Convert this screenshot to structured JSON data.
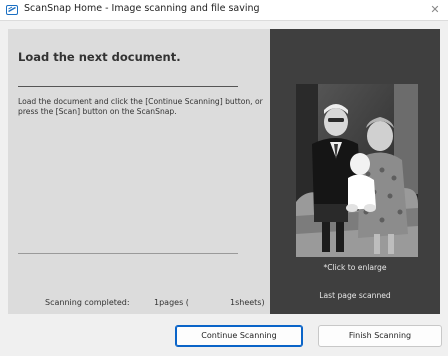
{
  "window": {
    "title": "ScanSnap Home - Image scanning and file saving",
    "close_glyph": "✕"
  },
  "left": {
    "heading": "Load the next document.",
    "instruction": "Load the document and click the [Continue Scanning] button, or press the [Scan] button on the ScanSnap.",
    "status_label": "Scanning completed:",
    "status_pages": "1pages (",
    "status_sheets": "1sheets)"
  },
  "preview": {
    "enlarge_hint": "*Click to enlarge",
    "last_page_label": "Last page scanned",
    "image_subject": "black-and-white family photo"
  },
  "buttons": {
    "continue": "Continue Scanning",
    "finish": "Finish Scanning"
  },
  "colors": {
    "accent": "#0a64c8",
    "preview_bg": "#3f3f3f",
    "panel_bg": "#dcdcdc"
  }
}
